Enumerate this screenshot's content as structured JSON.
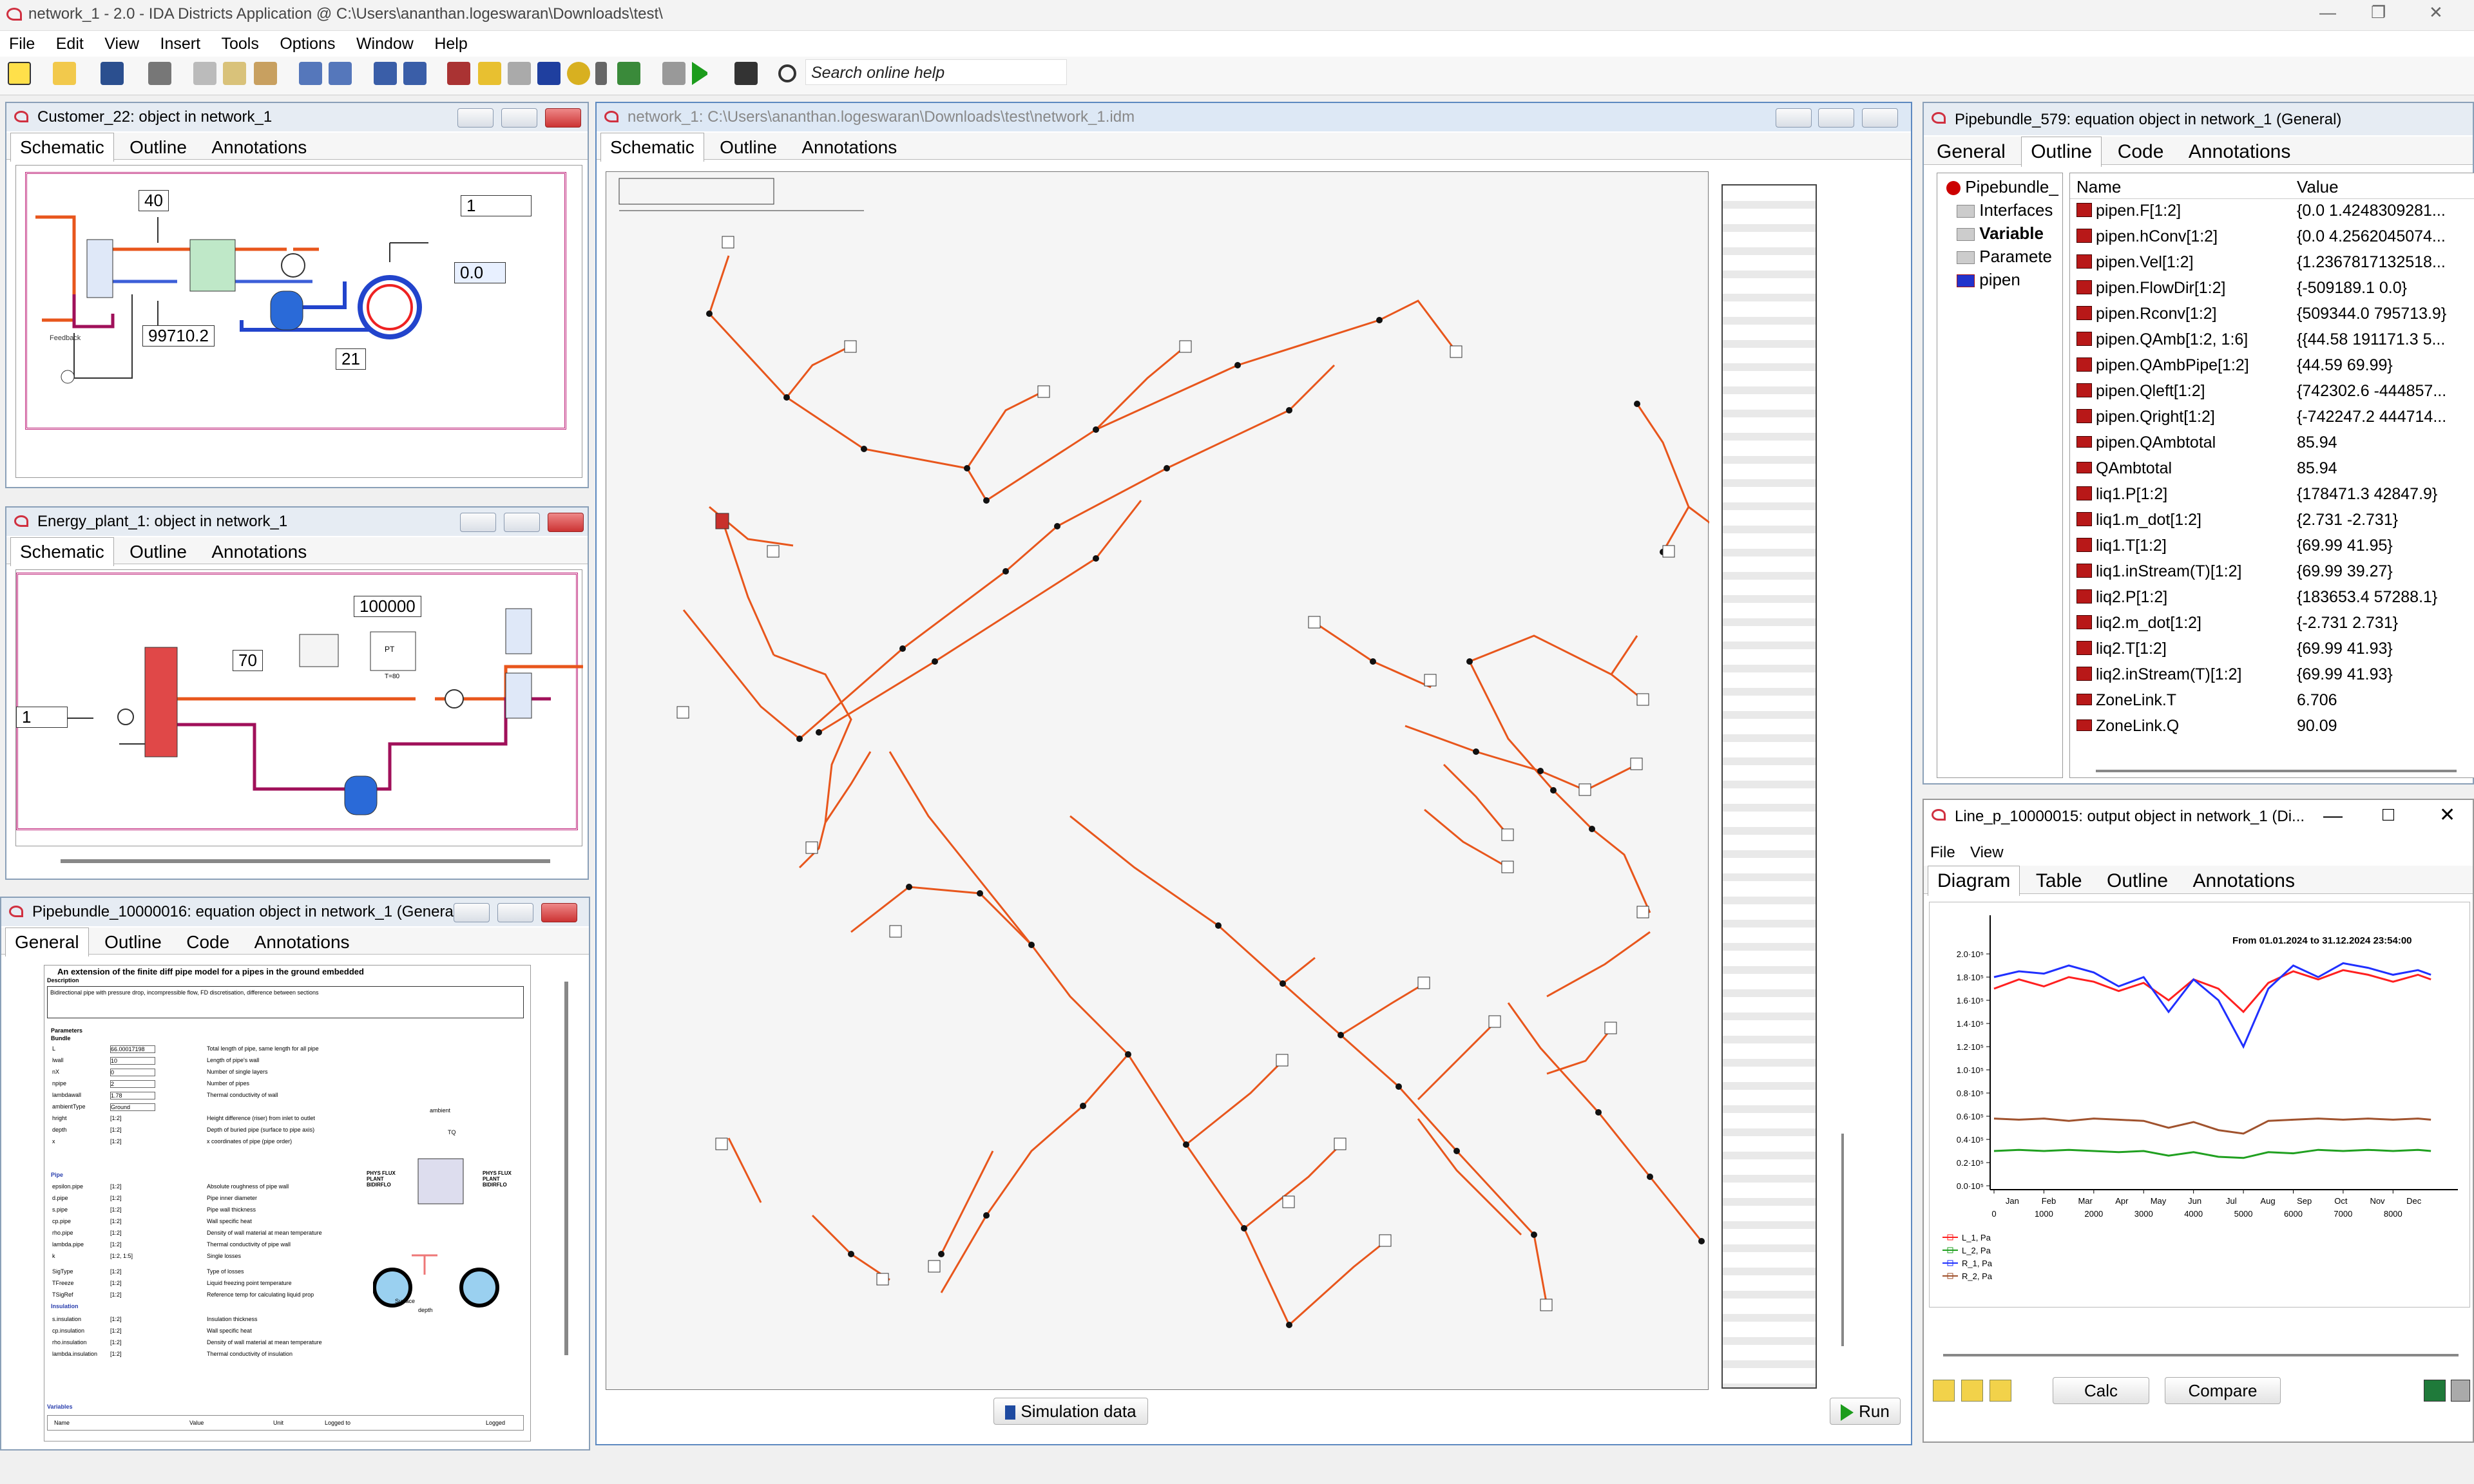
{
  "app": {
    "title": "network_1 - 2.0 - IDA Districts Application @ C:\\Users\\ananthan.logeswaran\\Downloads\\test\\",
    "menu": [
      "File",
      "Edit",
      "View",
      "Insert",
      "Tools",
      "Options",
      "Window",
      "Help"
    ],
    "search_placeholder": "Search online help"
  },
  "customer": {
    "title": "Customer_22: object in network_1",
    "tabs": [
      "Schematic",
      "Outline",
      "Annotations"
    ],
    "values": {
      "v40": "40",
      "v1": "1",
      "v00": "0.0",
      "v997": "99710.2",
      "v21": "21"
    },
    "feedback_label": "Feedback"
  },
  "energy": {
    "title": "Energy_plant_1: object in network_1",
    "tabs": [
      "Schematic",
      "Outline",
      "Annotations"
    ],
    "values": {
      "v100000": "100000",
      "v70": "70",
      "v1": "1"
    },
    "pt_label": "PT",
    "t_label": "T=80"
  },
  "pbsmall": {
    "title": "Pipebundle_10000016: equation object in network_1 (General)",
    "tabs": [
      "General",
      "Outline",
      "Code",
      "Annotations"
    ],
    "heading": "An extension of the finite diff pipe model for a pipes in the ground embedded",
    "description_label": "Description",
    "description": "Bidirectional pipe with pressure drop, incompressible flow, FD discretisation, difference between sections",
    "parameters_label": "Parameters",
    "bundle_label": "Bundle",
    "params": [
      {
        "name": "L",
        "val": "66.00017198",
        "desc": "Total length of pipe, same length for all pipe"
      },
      {
        "name": "lwall",
        "val": "10",
        "desc": "Length of pipe's wall"
      },
      {
        "name": "nX",
        "val": "0",
        "desc": "Number of single layers"
      },
      {
        "name": "npipe",
        "val": "2",
        "desc": "Number of pipes"
      },
      {
        "name": "lambdawall",
        "val": "1.78",
        "desc": "Thermal conductivity of wall"
      },
      {
        "name": "ambientType",
        "val": "Ground",
        "desc": ""
      },
      {
        "name": "hright",
        "val": "[1:2]",
        "desc": "Height difference (riser) from inlet to outlet"
      },
      {
        "name": "depth",
        "val": "[1:2]",
        "desc": "Depth of buried pipe (surface to pipe axis)"
      },
      {
        "name": "x",
        "val": "[1:2]",
        "desc": "x coordinates of pipe (pipe order)"
      }
    ],
    "pipe_label": "Pipe",
    "pipe_params": [
      {
        "name": "epsilon.pipe",
        "val": "[1:2]",
        "desc": "Absolute roughness of pipe wall"
      },
      {
        "name": "d.pipe",
        "val": "[1:2]",
        "desc": "Pipe inner diameter"
      },
      {
        "name": "s.pipe",
        "val": "[1:2]",
        "desc": "Pipe wall thickness"
      },
      {
        "name": "cp.pipe",
        "val": "[1:2]",
        "desc": "Wall specific heat"
      },
      {
        "name": "rho.pipe",
        "val": "[1:2]",
        "desc": "Density of wall material at mean temperature"
      },
      {
        "name": "lambda.pipe",
        "val": "[1:2]",
        "desc": "Thermal conductivity of pipe wall"
      },
      {
        "name": "k",
        "val": "[1:2, 1:5]",
        "desc": "Single losses"
      },
      {
        "name": "SigType",
        "val": "[1:2]",
        "desc": "Type of losses"
      },
      {
        "name": "TFreeze",
        "val": "[1:2]",
        "desc": "Liquid freezing point temperature"
      },
      {
        "name": "TSigRef",
        "val": "[1:2]",
        "desc": "Reference temp for calculating liquid prop"
      }
    ],
    "insulation_label": "Insulation",
    "ins_params": [
      {
        "name": "s.insulation",
        "val": "[1:2]",
        "desc": "Insulation thickness"
      },
      {
        "name": "cp.insulation",
        "val": "[1:2]",
        "desc": "Wall specific heat"
      },
      {
        "name": "rho.insulation",
        "val": "[1:2]",
        "desc": "Density of wall material at mean temperature"
      },
      {
        "name": "lambda.insulation",
        "val": "[1:2]",
        "desc": "Thermal conductivity of insulation"
      }
    ],
    "variables_label": "Variables",
    "var_cols": [
      "Name",
      "Value",
      "Unit",
      "Logged to",
      "Logged"
    ],
    "ambient_label": "ambient",
    "tq_label": "TQ",
    "surface_label": "Surface",
    "depth_label": "depth",
    "left_port": "PHYS FLUX PLANT BIDIRFLO",
    "right_port": "PHYS FLUX PLANT BIDIRFLO"
  },
  "network": {
    "title": "network_1: C:\\Users\\ananthan.logeswaran\\Downloads\\test\\network_1.idm",
    "tabs": [
      "Schematic",
      "Outline",
      "Annotations"
    ],
    "sim_button": "Simulation data",
    "run_button": "Run"
  },
  "pb579": {
    "title": "Pipebundle_579: equation object in network_1 (General)",
    "tabs": [
      "General",
      "Outline",
      "Code",
      "Annotations"
    ],
    "tree": [
      "Pipebundle_",
      "Interfaces",
      "Variable",
      "Paramete",
      "pipen"
    ],
    "cols": [
      "Name",
      "Value"
    ],
    "rows": [
      {
        "name": "pipen.F[1:2]",
        "value": "{0.0 1.4248309281..."
      },
      {
        "name": "pipen.hConv[1:2]",
        "value": "{0.0 4.2562045074..."
      },
      {
        "name": "pipen.Vel[1:2]",
        "value": "{1.2367817132518..."
      },
      {
        "name": "pipen.FlowDir[1:2]",
        "value": "{-509189.1 0.0}"
      },
      {
        "name": "pipen.Rconv[1:2]",
        "value": "{509344.0 795713.9}"
      },
      {
        "name": "pipen.QAmb[1:2, 1:6]",
        "value": "{{44.58 191171.3 5..."
      },
      {
        "name": "pipen.QAmbPipe[1:2]",
        "value": "{44.59 69.99}"
      },
      {
        "name": "pipen.Qleft[1:2]",
        "value": "{742302.6 -444857..."
      },
      {
        "name": "pipen.Qright[1:2]",
        "value": "{-742247.2 444714..."
      },
      {
        "name": "pipen.QAmbtotal",
        "value": "85.94"
      },
      {
        "name": "QAmbtotal",
        "value": "85.94"
      },
      {
        "name": "liq1.P[1:2]",
        "value": "{178471.3 42847.9}"
      },
      {
        "name": "liq1.m_dot[1:2]",
        "value": "{2.731 -2.731}"
      },
      {
        "name": "liq1.T[1:2]",
        "value": "{69.99 41.95}"
      },
      {
        "name": "liq1.inStream(T)[1:2]",
        "value": "{69.99 39.27}"
      },
      {
        "name": "liq2.P[1:2]",
        "value": "{183653.4 57288.1}"
      },
      {
        "name": "liq2.m_dot[1:2]",
        "value": "{-2.731 2.731}"
      },
      {
        "name": "liq2.T[1:2]",
        "value": "{69.99 41.93}"
      },
      {
        "name": "liq2.inStream(T)[1:2]",
        "value": "{69.99 41.93}"
      },
      {
        "name": "ZoneLink.T",
        "value": "6.706"
      },
      {
        "name": "ZoneLink.Q",
        "value": "90.09"
      }
    ]
  },
  "output": {
    "title": "Line_p_10000015: output object in network_1 (Di...",
    "menu": [
      "File",
      "View"
    ],
    "tabs": [
      "Diagram",
      "Table",
      "Outline",
      "Annotations"
    ],
    "calc_button": "Calc",
    "compare_button": "Compare"
  },
  "chart_data": {
    "type": "line",
    "title": "From 01.01.2024 to 31.12.2024 23:54:00",
    "xlabel": "",
    "ylabel": "",
    "x_ticks": [
      0,
      1000,
      2000,
      3000,
      4000,
      5000,
      6000,
      7000,
      8000
    ],
    "month_labels": [
      "Jan",
      "Feb",
      "Mar",
      "Apr",
      "May",
      "Jun",
      "Jul",
      "Aug",
      "Sep",
      "Oct",
      "Nov",
      "Dec"
    ],
    "y_tick_labels": [
      "0.0·10⁵",
      "0.2·10⁵",
      "0.4·10⁵",
      "0.6·10⁵",
      "0.8·10⁵",
      "1.0·10⁵",
      "1.2·10⁵",
      "1.4·10⁵",
      "1.6·10⁵",
      "1.8·10⁵",
      "2.0·10⁵"
    ],
    "xlim": [
      0,
      8784
    ],
    "ylim": [
      0,
      200000
    ],
    "grid": false,
    "legend_position": "bottom-left",
    "series": [
      {
        "name": "L_1, Pa",
        "color": "#ff2020",
        "x": [
          0,
          500,
          1000,
          1500,
          2000,
          2500,
          3000,
          3500,
          4000,
          4500,
          5000,
          5500,
          6000,
          6500,
          7000,
          7500,
          8000,
          8500,
          8760
        ],
        "y": [
          170000,
          178000,
          172000,
          180000,
          176000,
          168000,
          175000,
          160000,
          178000,
          170000,
          150000,
          175000,
          185000,
          178000,
          186000,
          182000,
          176000,
          182000,
          178000
        ]
      },
      {
        "name": "L_2, Pa",
        "color": "#20a020",
        "x": [
          0,
          500,
          1000,
          1500,
          2000,
          2500,
          3000,
          3500,
          4000,
          4500,
          5000,
          5500,
          6000,
          6500,
          7000,
          7500,
          8000,
          8500,
          8760
        ],
        "y": [
          30000,
          31000,
          30000,
          31000,
          30000,
          29000,
          30000,
          26000,
          29000,
          25000,
          24000,
          29000,
          28000,
          31000,
          30000,
          31000,
          30000,
          31000,
          30000
        ]
      },
      {
        "name": "R_1, Pa",
        "color": "#2030ff",
        "x": [
          0,
          500,
          1000,
          1500,
          2000,
          2500,
          3000,
          3500,
          4000,
          4500,
          5000,
          5500,
          6000,
          6500,
          7000,
          7500,
          8000,
          8500,
          8760
        ],
        "y": [
          180000,
          185000,
          183000,
          190000,
          184000,
          172000,
          180000,
          150000,
          178000,
          160000,
          120000,
          170000,
          190000,
          180000,
          192000,
          188000,
          182000,
          186000,
          182000
        ]
      },
      {
        "name": "R_2, Pa",
        "color": "#a0522d",
        "x": [
          0,
          500,
          1000,
          1500,
          2000,
          2500,
          3000,
          3500,
          4000,
          4500,
          5000,
          5500,
          6000,
          6500,
          7000,
          7500,
          8000,
          8500,
          8760
        ],
        "y": [
          58000,
          57000,
          58000,
          56000,
          58000,
          57000,
          56000,
          50000,
          55000,
          48000,
          45000,
          56000,
          57000,
          58000,
          57000,
          58000,
          57000,
          58000,
          57000
        ]
      }
    ]
  }
}
